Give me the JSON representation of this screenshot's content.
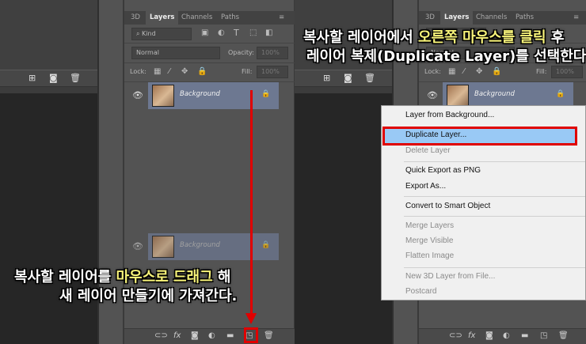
{
  "tabs": [
    "3D",
    "Layers",
    "Channels",
    "Paths"
  ],
  "filter": {
    "kind": "Kind"
  },
  "blend": {
    "mode": "Normal",
    "opacity_label": "Opacity:",
    "opacity": "100%"
  },
  "lock": {
    "label": "Lock:",
    "fill_label": "Fill:",
    "fill": "100%"
  },
  "layer": {
    "name": "Background"
  },
  "context_menu": {
    "items": [
      {
        "label": "Layer from Background...",
        "enabled": true
      },
      {
        "label": "Duplicate Layer...",
        "enabled": true,
        "highlighted": true
      },
      {
        "label": "Delete Layer",
        "enabled": false
      },
      {
        "label": "Quick Export as PNG",
        "enabled": true
      },
      {
        "label": "Export As...",
        "enabled": true
      },
      {
        "label": "Convert to Smart Object",
        "enabled": true
      },
      {
        "label": "Merge Layers",
        "enabled": false
      },
      {
        "label": "Merge Visible",
        "enabled": false
      },
      {
        "label": "Flatten Image",
        "enabled": false
      },
      {
        "label": "New 3D Layer from File...",
        "enabled": false
      },
      {
        "label": "Postcard",
        "enabled": false
      }
    ]
  },
  "caption_left": {
    "line1_a": "복사할 레이어를 ",
    "line1_hl": "마우스로 드래그",
    "line1_b": " 해",
    "line2": "새 레이어 만들기에 가져간다."
  },
  "caption_right": {
    "line1_a": "복사할 레이어에서 ",
    "line1_hl": "오른쪽 마우스를 클릭",
    "line1_b": " 후",
    "line2": "레이어 복제(Duplicate Layer)를 선택한다."
  },
  "colors": {
    "highlight_box": "#e00000",
    "annotation_arrow": "#e00000",
    "caption_highlight": "#f8f47a",
    "menu_selection": "#99c9f5"
  }
}
